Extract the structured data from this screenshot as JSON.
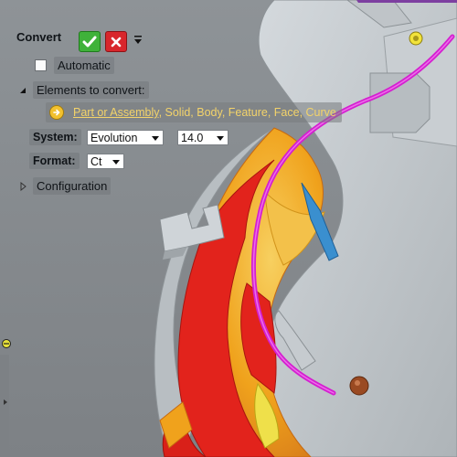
{
  "panel": {
    "title": "Convert",
    "automatic_label": "Automatic",
    "elements_label": "Elements to convert:",
    "elements_value_link": "Part or Assembly",
    "elements_value_rest": ", Solid, Body, Feature, Face, Curve",
    "system_label": "System:",
    "system_value": "Evolution",
    "version_value": "14.0",
    "format_label": "Format:",
    "format_value": "Ct",
    "configuration_label": "Configuration"
  },
  "colors": {
    "ok": "#3fb23a",
    "cancel": "#d8262b",
    "link": "#f3d36a"
  }
}
